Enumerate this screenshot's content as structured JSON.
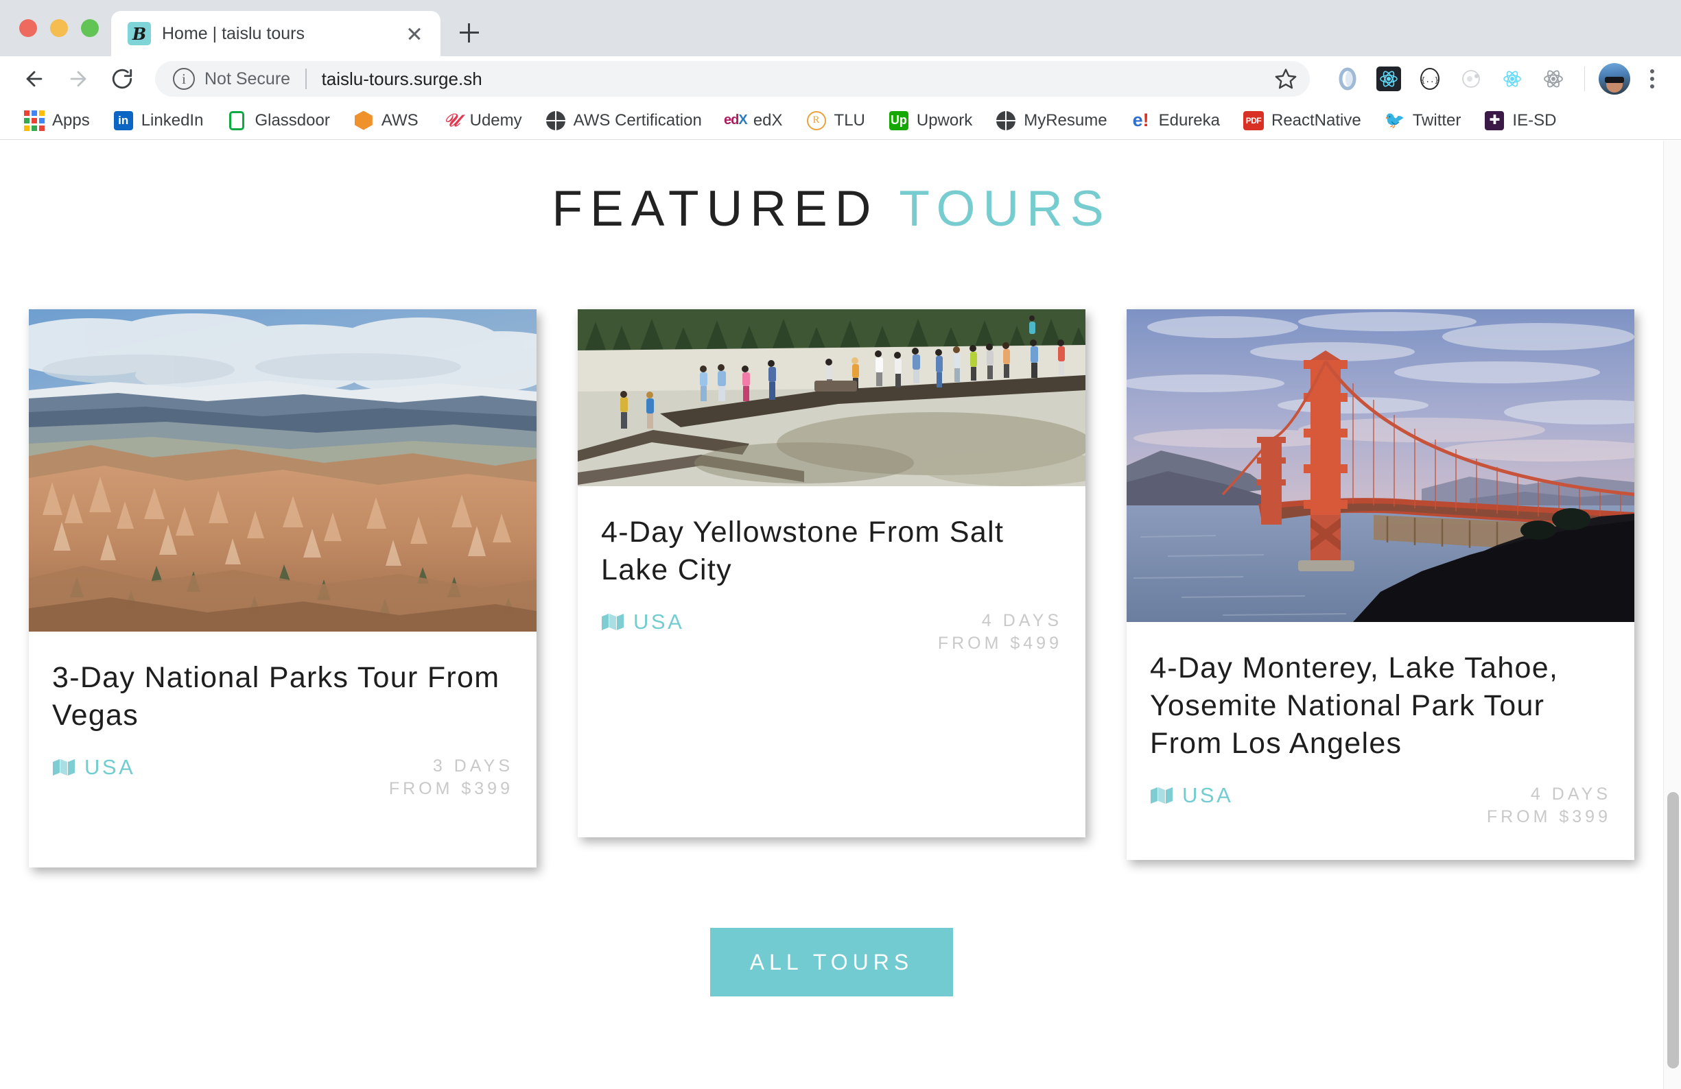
{
  "browser": {
    "tab": {
      "title": "Home | taislu tours",
      "favicon_glyph": "B",
      "favicon_name": "taislu-tours-favicon",
      "close_name": "close-tab-icon"
    },
    "new_tab_label": "+",
    "toolbar": {
      "back_name": "back-arrow-icon",
      "forward_name": "forward-arrow-icon",
      "reload_name": "reload-icon",
      "security_label": "Not Secure",
      "url": "taislu-tours.surge.sh",
      "star_name": "bookmark-star-icon",
      "extensions": [
        {
          "name": "extension-icon-ring",
          "glyph": ""
        },
        {
          "name": "extension-icon-react-dark",
          "glyph": ""
        },
        {
          "name": "extension-icon-braces",
          "glyph": "{...}"
        },
        {
          "name": "extension-icon-atom-faded",
          "glyph": ""
        },
        {
          "name": "extension-icon-react-devtools",
          "glyph": ""
        },
        {
          "name": "extension-icon-react-grey",
          "glyph": ""
        }
      ],
      "avatar_name": "profile-avatar",
      "menu_name": "chrome-menu-icon"
    },
    "bookmarks": [
      {
        "label": "Apps",
        "icon": "apps-grid-icon"
      },
      {
        "label": "LinkedIn",
        "icon": "linkedin-icon"
      },
      {
        "label": "Glassdoor",
        "icon": "glassdoor-icon"
      },
      {
        "label": "AWS",
        "icon": "aws-cube-icon"
      },
      {
        "label": "Udemy",
        "icon": "udemy-icon"
      },
      {
        "label": "AWS Certification",
        "icon": "globe-icon"
      },
      {
        "label": "edX",
        "icon": "edx-icon"
      },
      {
        "label": "TLU",
        "icon": "tlu-icon"
      },
      {
        "label": "Upwork",
        "icon": "upwork-icon"
      },
      {
        "label": "MyResume",
        "icon": "globe-icon"
      },
      {
        "label": "Edureka",
        "icon": "edureka-icon"
      },
      {
        "label": "ReactNative",
        "icon": "pdf-icon"
      },
      {
        "label": "Twitter",
        "icon": "twitter-bird-icon"
      },
      {
        "label": "IE-SD",
        "icon": "ie-sd-icon"
      }
    ]
  },
  "page": {
    "section_title_main": "FEATURED",
    "section_title_accent": "TOURS",
    "cta_label": "ALL TOURS",
    "accent_color": "#71cbd0",
    "title_color": "#222222",
    "meta_color": "#c9c9c9",
    "cards": [
      {
        "title": "3-Day National Parks Tour From Vegas",
        "country": "USA",
        "country_icon": "map-icon",
        "duration": "3 DAYS",
        "price": "FROM $399",
        "image_name": "bryce-canyon-photo"
      },
      {
        "title": "4-Day Yellowstone From Salt Lake City",
        "country": "USA",
        "country_icon": "map-icon",
        "duration": "4 DAYS",
        "price": "FROM $499",
        "image_name": "yellowstone-boardwalk-photo"
      },
      {
        "title": "4-Day Monterey, Lake Tahoe, Yosemite National Park Tour From Los Angeles",
        "country": "USA",
        "country_icon": "map-icon",
        "duration": "4 DAYS",
        "price": "FROM $399",
        "image_name": "golden-gate-bridge-photo"
      }
    ]
  }
}
